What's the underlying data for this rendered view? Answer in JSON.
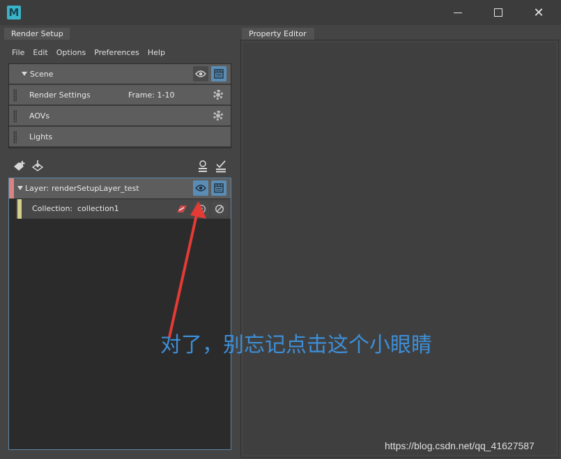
{
  "window": {
    "logo_letter": "M",
    "controls": [
      "minimize",
      "maximize",
      "close"
    ],
    "close_glyph": "✕"
  },
  "tabs": {
    "render_setup": "Render Setup",
    "property_editor": "Property Editor"
  },
  "menu": [
    "File",
    "Edit",
    "Options",
    "Preferences",
    "Help"
  ],
  "scene": {
    "label": "Scene",
    "rows": [
      {
        "label": "Render Settings",
        "extra": "Frame: 1-10",
        "icon": "gear-icon"
      },
      {
        "label": "AOVs",
        "icon": "gear-icon"
      },
      {
        "label": "Lights"
      }
    ]
  },
  "layers": {
    "layer_prefix": "Layer:",
    "layer_name": "renderSetupLayer_test",
    "collection_prefix": "Collection:",
    "collection_name": "collection1"
  },
  "annotation": {
    "text": "对了，别忘记点击这个小眼睛",
    "color": "#3d8fd8"
  },
  "arrow_color": "#e53a35",
  "watermark": "https://blog.csdn.net/qq_41627587"
}
